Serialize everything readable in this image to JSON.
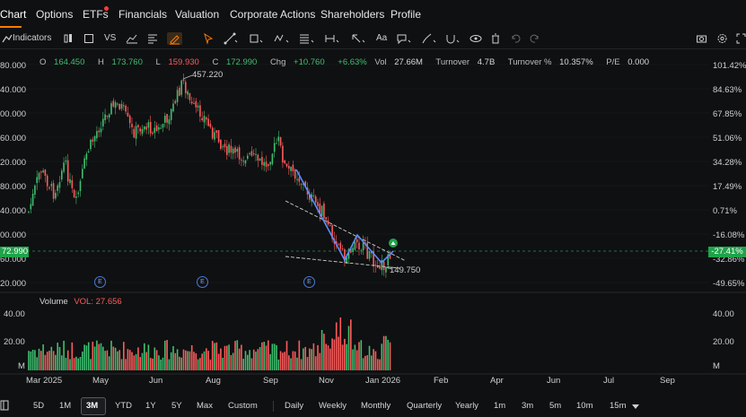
{
  "nav": {
    "items": [
      "Chart",
      "Options",
      "ETFs",
      "Financials",
      "Valuation",
      "Corporate Actions",
      "Shareholders",
      "Profile"
    ],
    "active": "Chart"
  },
  "toolbar": {
    "indicators_label": "Indicators",
    "vs_label": "VS",
    "aa_label": "Aa"
  },
  "ohlc": {
    "o_label": "O",
    "o": "164.450",
    "h_label": "H",
    "h": "173.760",
    "l_label": "L",
    "l": "159.930",
    "c_label": "C",
    "c": "172.990",
    "chg_label": "Chg",
    "chg": "+10.760",
    "chg_pct": "+6.63%",
    "vol_label": "Vol",
    "vol": "27.66M",
    "turnover_label": "Turnover",
    "turnover": "4.7B",
    "turnover_pct_label": "Turnover %",
    "turnover_pct": "10.357%",
    "pe_label": "P/E",
    "pe": "0.000"
  },
  "price_axis": [
    "80.000",
    "40.000",
    "00.000",
    "60.000",
    "20.000",
    "80.000",
    "40.000",
    "00.000",
    "60.000",
    "20.000"
  ],
  "pct_axis": [
    "101.42%",
    "84.63%",
    "67.85%",
    "51.06%",
    "34.28%",
    "17.49%",
    "0.71%",
    "-16.08%",
    "-32.86%",
    "-49.65%"
  ],
  "current_price_tag": "72.990",
  "current_pct_tag": "-27.41%",
  "annotations": {
    "high": "457.220",
    "low": "149.750"
  },
  "earnings_badge": "E",
  "volume": {
    "title": "Volume",
    "vol_label": "VOL:",
    "vol_value": "27.656",
    "axis_left": [
      "40.00",
      "20.00",
      "M"
    ],
    "axis_right": [
      "40.00",
      "20.00",
      "M"
    ]
  },
  "date_axis": [
    "Mar 2025",
    "May",
    "Jun",
    "Aug",
    "Sep",
    "Nov",
    "Jan 2026",
    "Feb",
    "Apr",
    "Jun",
    "Jul",
    "Sep"
  ],
  "bottom": {
    "ranges": [
      "5D",
      "1M",
      "3M",
      "YTD",
      "1Y",
      "5Y",
      "Max",
      "Custom"
    ],
    "active_range": "3M",
    "intervals": [
      "Daily",
      "Weekly",
      "Monthly",
      "Quarterly",
      "Yearly",
      "1m",
      "3m",
      "5m",
      "10m",
      "15m"
    ]
  },
  "colors": {
    "up": "#3fbf6f",
    "down": "#ff5b5b",
    "accent": "#ff7a00",
    "pattern": "#5b8cff",
    "trend": "#cfcfcf"
  }
}
